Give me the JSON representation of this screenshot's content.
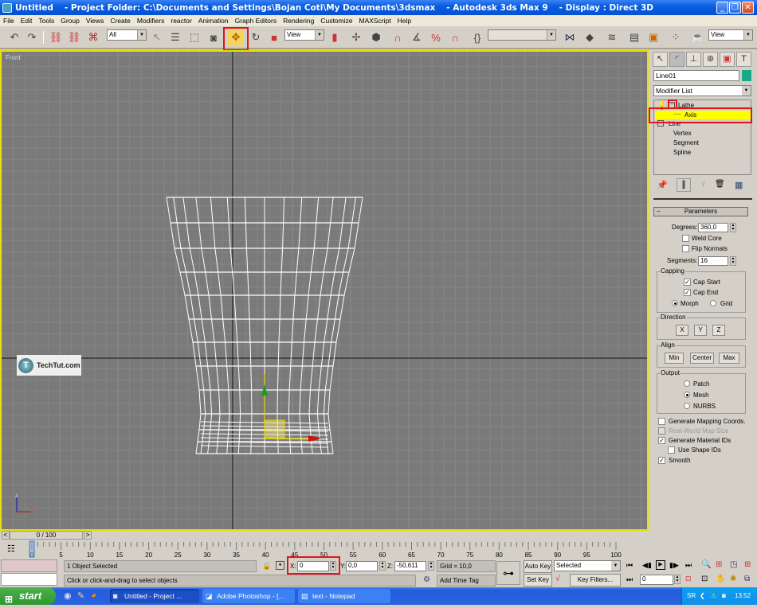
{
  "window": {
    "title_doc": "Untitled",
    "title_project": "- Project Folder: C:\\Documents and Settings\\Bojan Coti\\My Documents\\3dsmax",
    "title_app": "- Autodesk 3ds Max 9",
    "title_display": "- Display : Direct 3D"
  },
  "menu": [
    "File",
    "Edit",
    "Tools",
    "Group",
    "Views",
    "Create",
    "Modifiers",
    "reactor",
    "Animation",
    "Graph Editors",
    "Rendering",
    "Customize",
    "MAXScript",
    "Help"
  ],
  "toolbar": {
    "selection_filter": "All",
    "ref_coord": "View",
    "named_selection": "",
    "view_right": "View",
    "active_tool": "select-and-move"
  },
  "viewport": {
    "label": "Front",
    "watermark": "TechTut.com",
    "axis_z": "z",
    "axis_x": "x"
  },
  "command_panel": {
    "object_name": "Line01",
    "object_color": "#1aa88a",
    "modifier_list": "Modifier List",
    "stack": [
      {
        "label": "Lathe",
        "level": 0
      },
      {
        "label": "Axis",
        "level": 1,
        "selected": true
      },
      {
        "label": "Line",
        "level": 0
      },
      {
        "label": "Vertex",
        "level": 1
      },
      {
        "label": "Segment",
        "level": 1
      },
      {
        "label": "Spline",
        "level": 1
      }
    ],
    "parameters": {
      "header": "Parameters",
      "degrees_label": "Degrees:",
      "degrees": "360,0",
      "weld_core": "Weld Core",
      "flip_normals": "Flip Normals",
      "segments_label": "Segments:",
      "segments": "16",
      "capping": "Capping",
      "cap_start": "Cap Start",
      "cap_end": "Cap End",
      "morph": "Morph",
      "grid": "Grid",
      "direction": "Direction",
      "dir_x": "X",
      "dir_y": "Y",
      "dir_z": "Z",
      "align": "Align",
      "align_min": "Min",
      "align_center": "Center",
      "align_max": "Max",
      "output": "Output",
      "patch": "Patch",
      "mesh": "Mesh",
      "nurbs": "NURBS",
      "gen_mapping": "Generate Mapping Coords.",
      "real_world": "Real-World Map Size",
      "gen_matids": "Generate Material IDs",
      "use_shape_ids": "Use Shape IDs",
      "smooth": "Smooth"
    }
  },
  "timeline": {
    "frame_display": "0 / 100",
    "ticks": [
      "0",
      "5",
      "10",
      "15",
      "20",
      "25",
      "30",
      "35",
      "40",
      "45",
      "50",
      "55",
      "60",
      "65",
      "70",
      "75",
      "80",
      "85",
      "90",
      "95",
      "100"
    ]
  },
  "status": {
    "selection": "1 Object Selected",
    "prompt": "Click or click-and-drag to select objects",
    "x_label": "X:",
    "x_value": "0",
    "y_label": "Y:",
    "y_value": "0,0",
    "z_label": "Z:",
    "z_value": "-50,611",
    "grid": "Grid = 10,0",
    "add_time_tag": "Add Time Tag",
    "auto_key": "Auto Key",
    "set_key": "Set Key",
    "key_mode": "Selected",
    "key_filters": "Key Filters...",
    "current_frame": "0"
  },
  "taskbar": {
    "start": "start",
    "tasks": [
      "Untitled     - Project ...",
      "Adobe Photoshop - [...",
      "text - Notepad"
    ],
    "lang": "SR",
    "clock": "13:52"
  }
}
